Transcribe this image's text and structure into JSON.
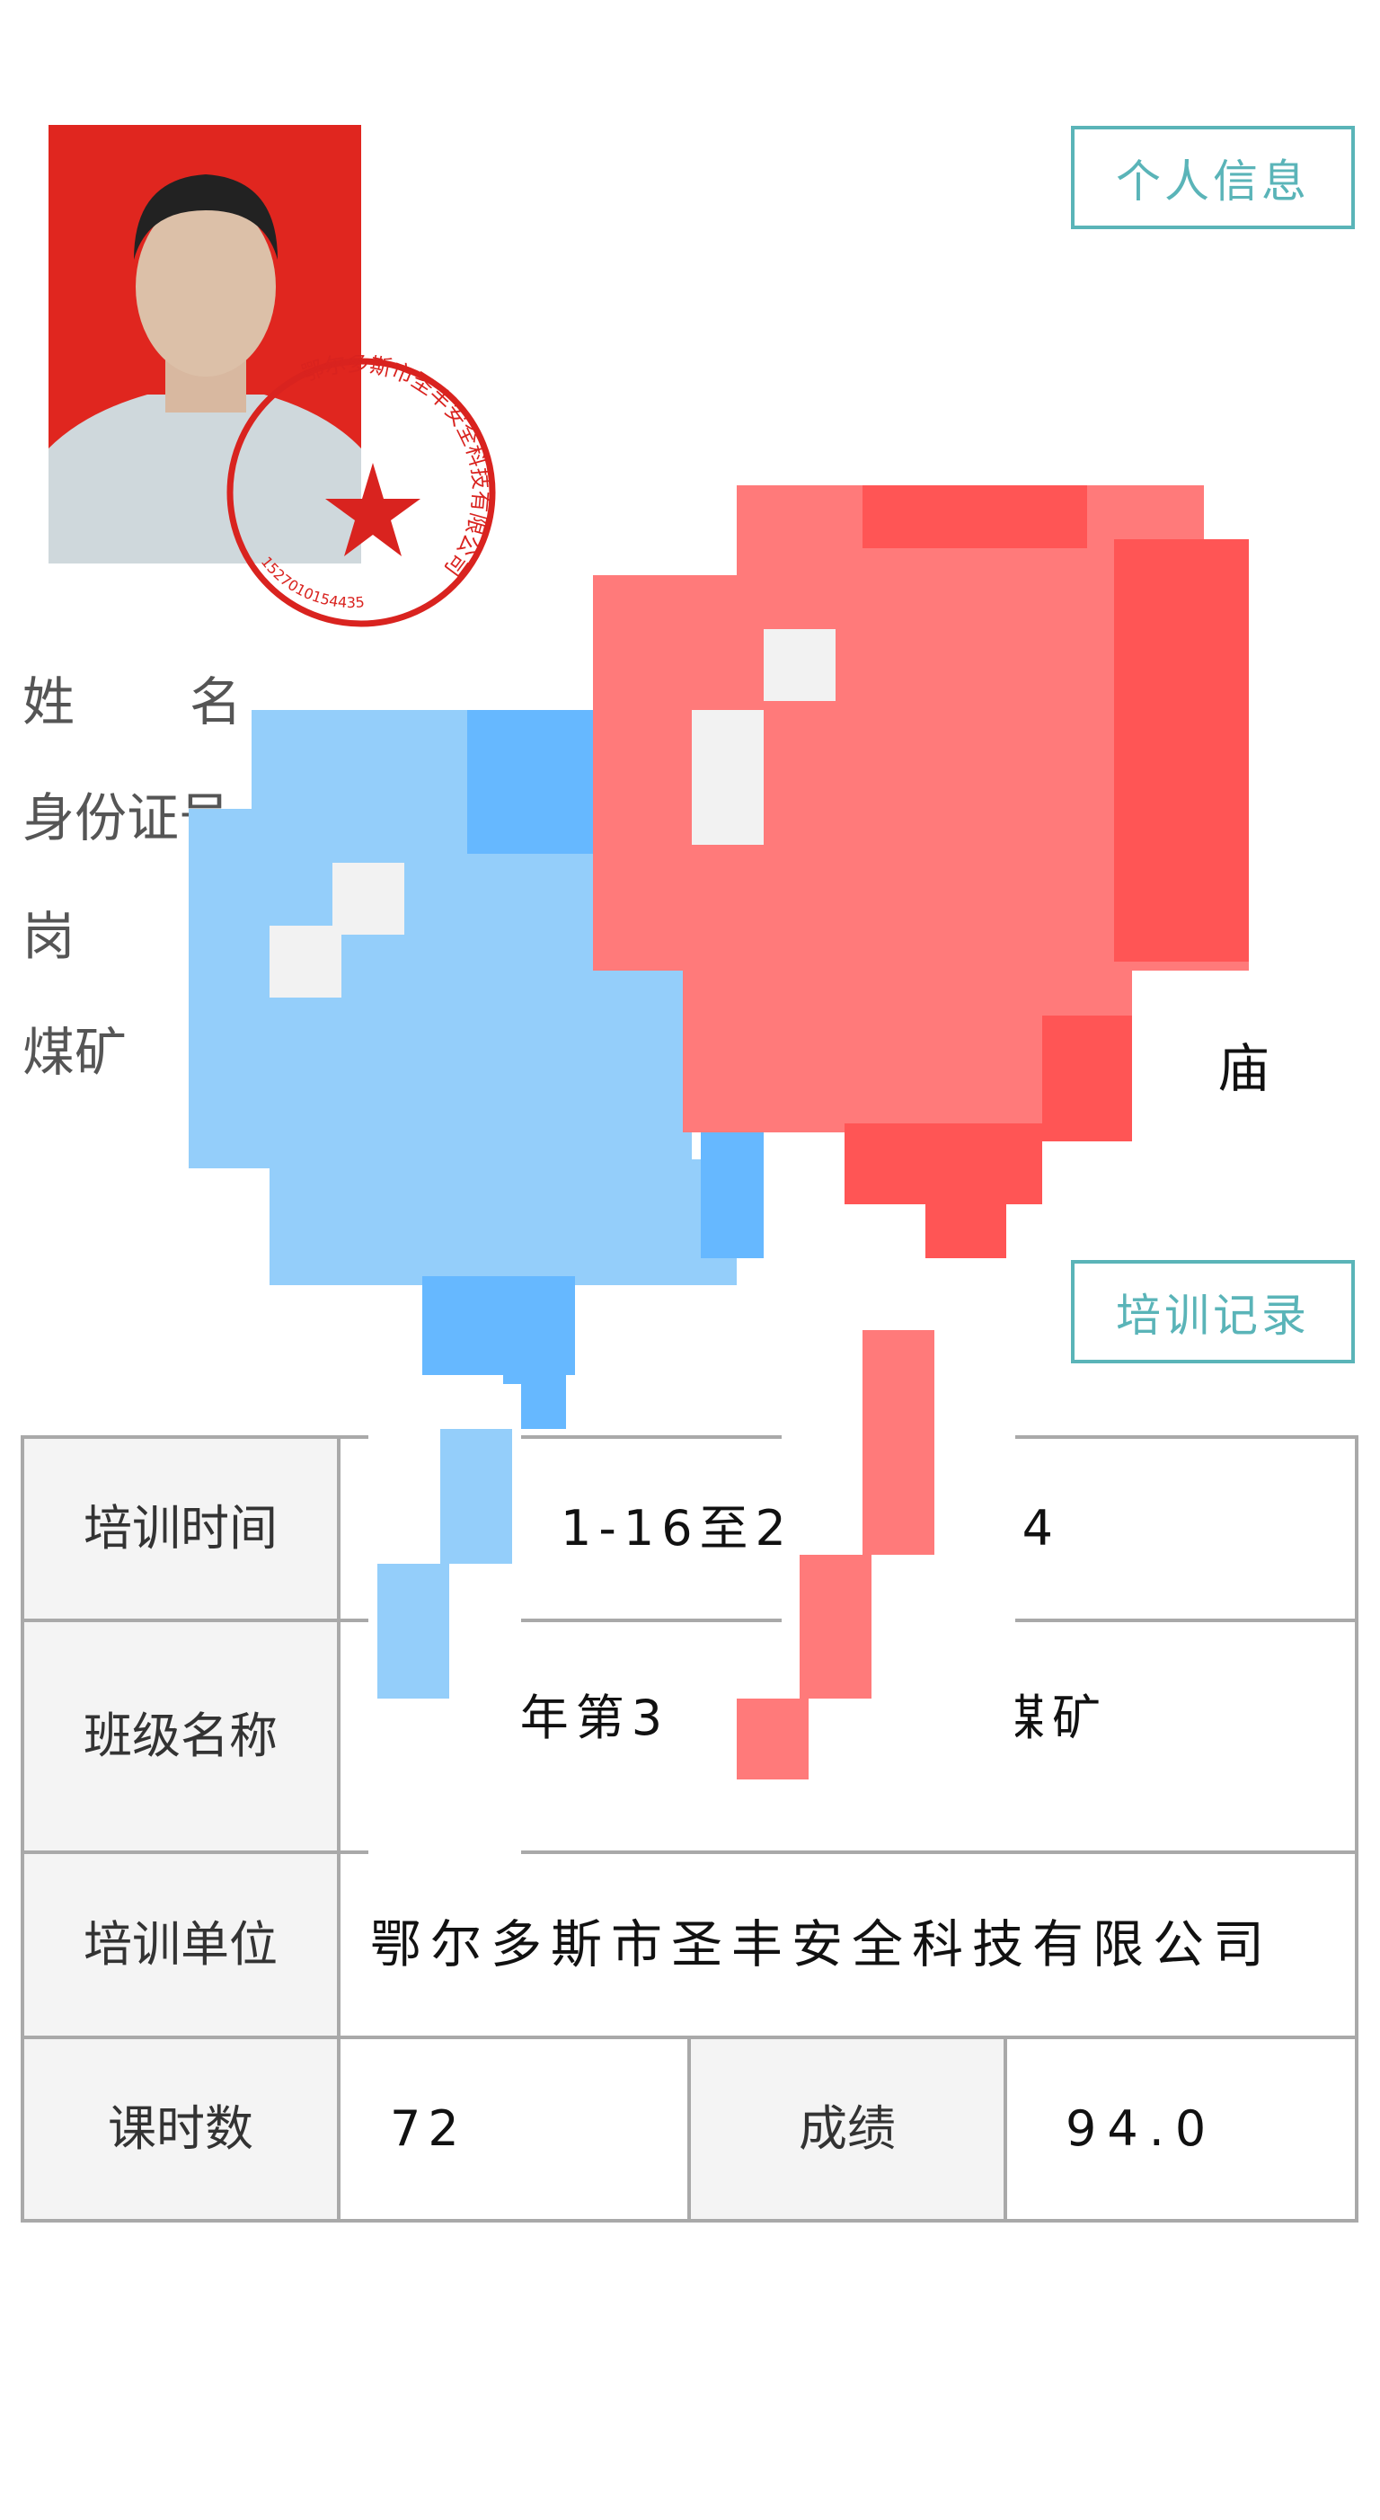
{
  "buttons": {
    "personal_info": "个人信息",
    "training_record": "培训记录"
  },
  "stamp": {
    "name": "鄂尔多斯市圣丰安全科技有限公司",
    "code": "1527010154435"
  },
  "personal": {
    "name_label": "姓　　名",
    "name_value_fragment": "：",
    "id_label": "身份证号",
    "id_label_visible": "身份证",
    "post_label": "岗",
    "mine_label": "煤矿",
    "mine_value_fragment": "庙"
  },
  "training": {
    "rows": [
      {
        "label": "培训时间",
        "value_fragments": [
          "1-16至20",
          "24"
        ]
      },
      {
        "label": "班级名称",
        "value_fragments": [
          "22年第3",
          "林庙煤矿"
        ]
      },
      {
        "label": "培训单位",
        "value": "鄂尔多斯市圣丰安全科技有限公司"
      }
    ],
    "hours_label": "课时数",
    "hours_value": "72",
    "score_label": "成绩",
    "score_value": "94.0"
  },
  "colors": {
    "accent": "#5ab4b8",
    "photo_bg": "#e0261f",
    "stamp": "#d9231f",
    "balloon_red": "#ff7a7a",
    "balloon_blue": "#94cefa"
  }
}
